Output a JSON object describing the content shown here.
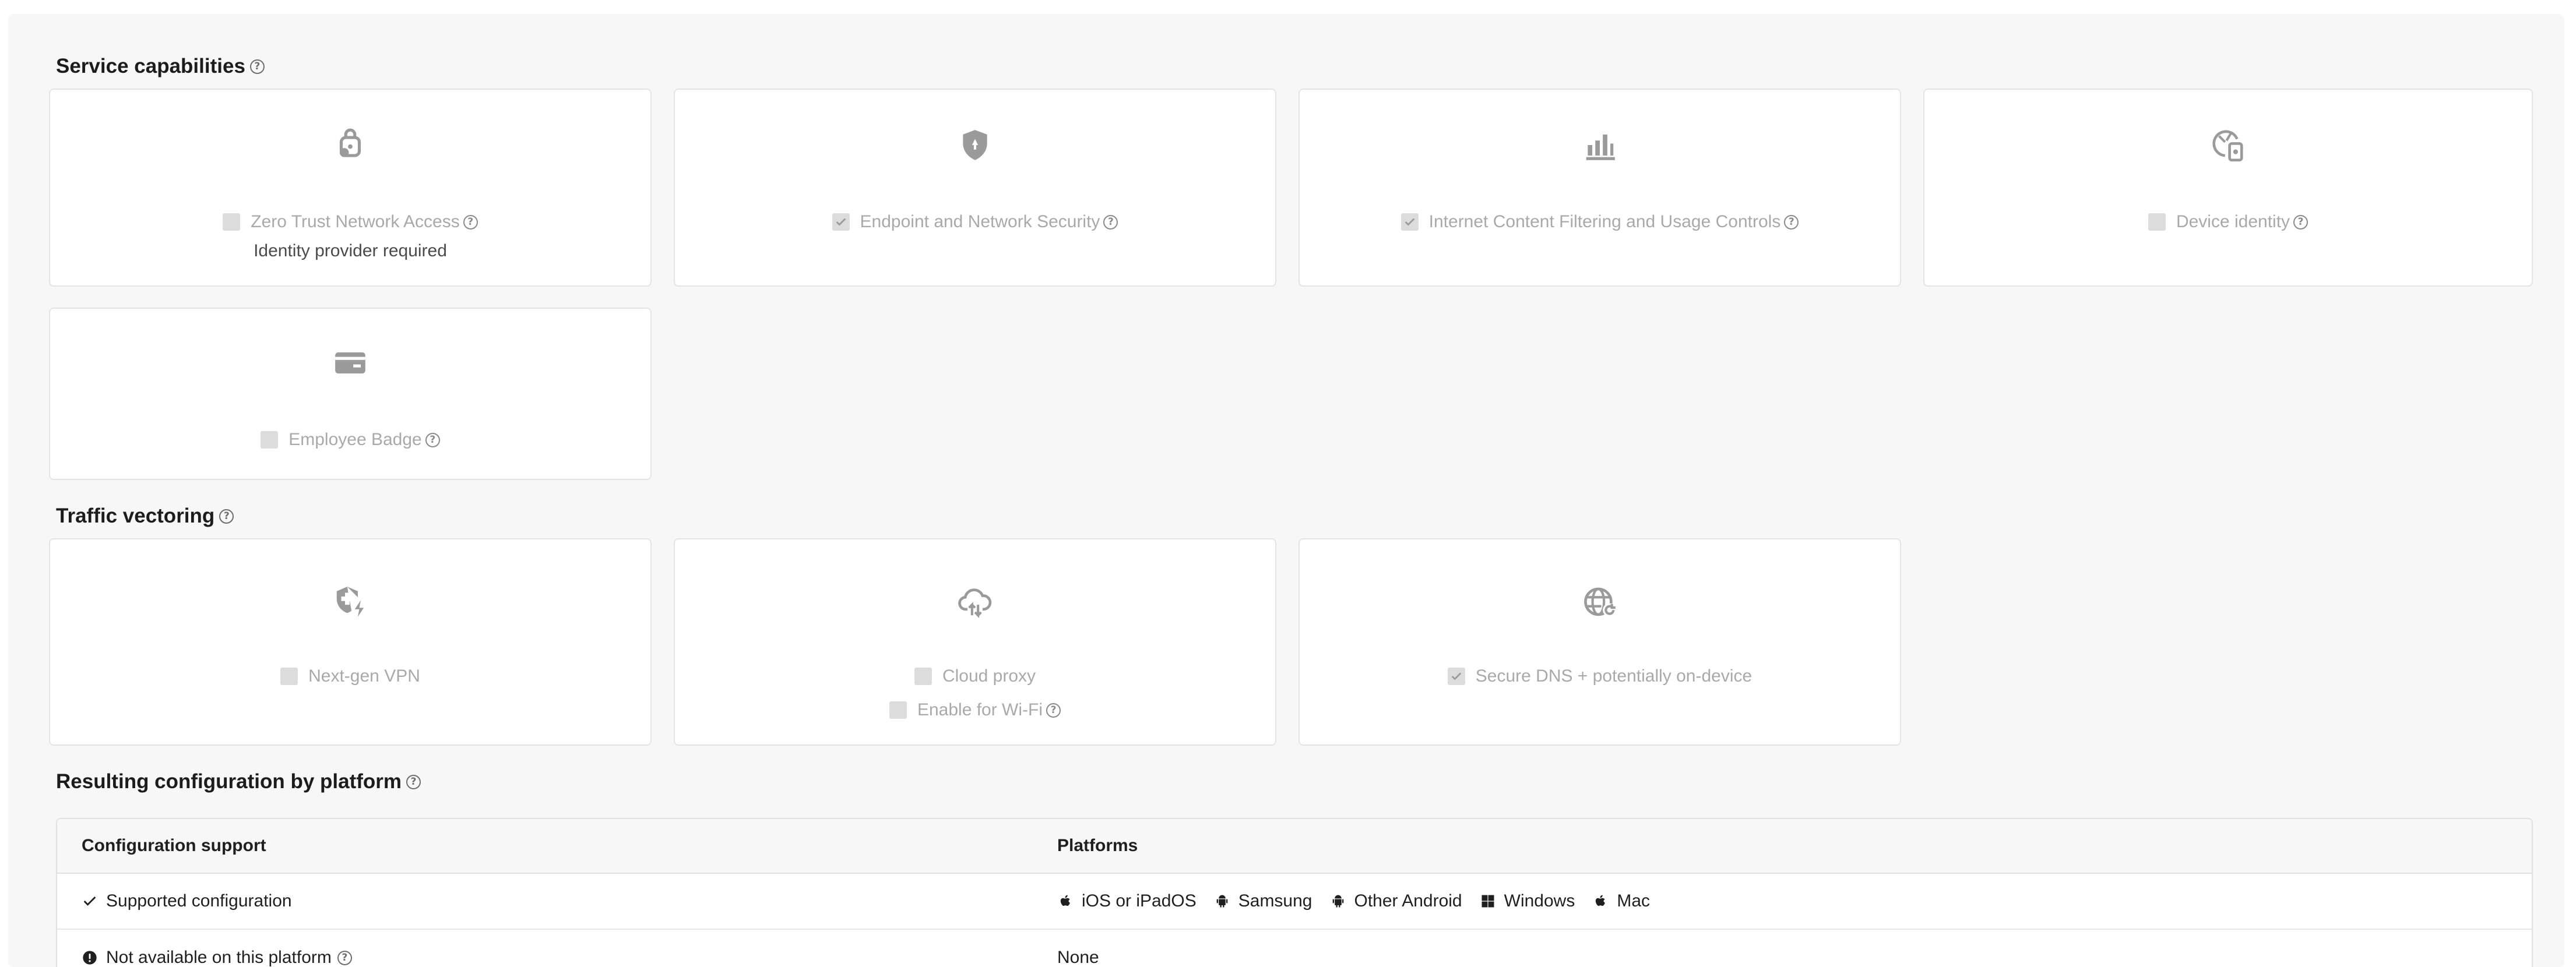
{
  "sections": {
    "service_capabilities": {
      "title": "Service capabilities",
      "cards": [
        {
          "icon": "lock-key-icon",
          "label": "Zero Trust Network Access",
          "checked": false,
          "has_help": true,
          "note": "Identity provider required"
        },
        {
          "icon": "shield-icon",
          "label": "Endpoint and Network Security",
          "checked": true,
          "has_help": true
        },
        {
          "icon": "bar-chart-icon",
          "label": "Internet Content Filtering and Usage Controls",
          "checked": true,
          "has_help": true
        },
        {
          "icon": "device-identity-icon",
          "label": "Device identity",
          "checked": false,
          "has_help": true
        },
        {
          "icon": "badge-card-icon",
          "label": "Employee Badge",
          "checked": false,
          "has_help": true
        }
      ]
    },
    "traffic_vectoring": {
      "title": "Traffic vectoring",
      "cards": [
        {
          "icon": "shield-bolt-icon",
          "label": "Next-gen VPN",
          "checked": false
        },
        {
          "icon": "cloud-transfer-icon",
          "label": "Cloud proxy",
          "checked": false,
          "sub_label": "Enable for Wi-Fi",
          "sub_checked": false
        },
        {
          "icon": "globe-refresh-icon",
          "label": "Secure DNS + potentially on-device",
          "checked": true
        }
      ]
    },
    "resulting_config": {
      "title": "Resulting configuration by platform",
      "columns": [
        "Configuration support",
        "Platforms"
      ],
      "rows": [
        {
          "status": "Supported configuration",
          "status_icon": "check-icon",
          "platforms": [
            {
              "icon": "apple-icon",
              "name": "iOS or iPadOS"
            },
            {
              "icon": "android-icon",
              "name": "Samsung"
            },
            {
              "icon": "android-icon",
              "name": "Other Android"
            },
            {
              "icon": "windows-icon",
              "name": "Windows"
            },
            {
              "icon": "apple-icon",
              "name": "Mac"
            }
          ]
        },
        {
          "status": "Not available on this platform",
          "status_icon": "alert-circle-icon",
          "platforms_text": "None"
        }
      ]
    }
  },
  "colors": {
    "panel": "#f7f7f7",
    "card_border": "#e4e4e4",
    "muted_text": "#a9a9a9",
    "icon": "#a0a0a0"
  }
}
